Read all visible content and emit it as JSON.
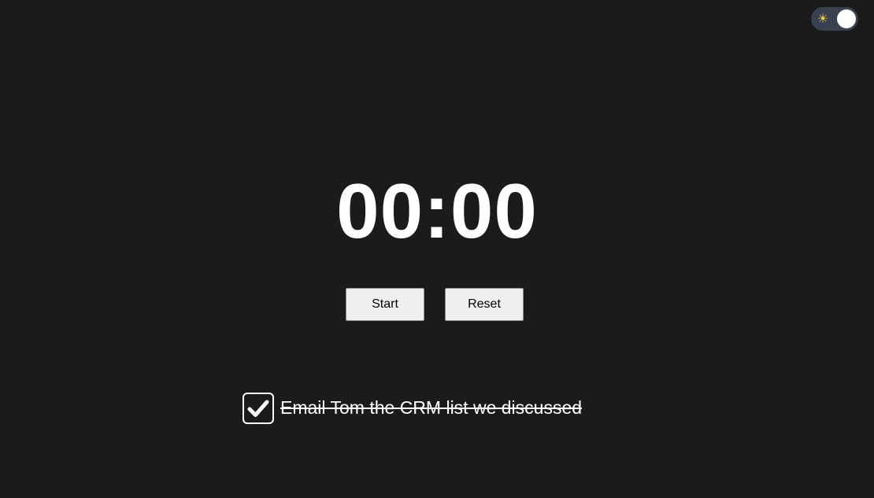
{
  "header": {
    "theme_toggle": {
      "icon": "sun-icon",
      "glyph": "☀",
      "state": "on"
    }
  },
  "timer": {
    "display": "00:00"
  },
  "controls": {
    "start_label": "Start",
    "reset_label": "Reset"
  },
  "task": {
    "text": "Email Tom the CRM list we discussed",
    "completed": true
  },
  "colors": {
    "background": "#1b1b1b",
    "toggle_track": "#38414f",
    "text": "#ffffff",
    "sun": "#f5c542"
  }
}
